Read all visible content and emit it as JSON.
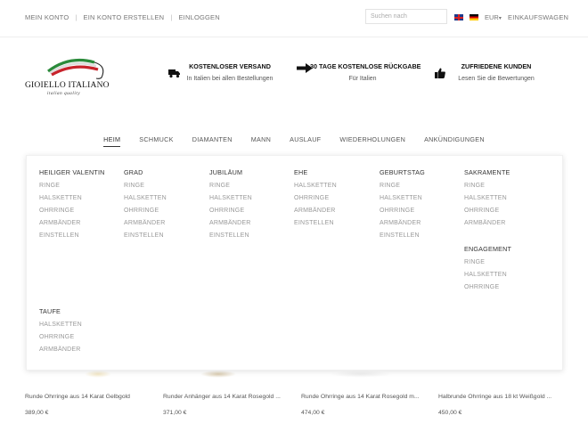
{
  "topbar": {
    "links": [
      "MEIN KONTO",
      "EIN KONTO ERSTELLEN",
      "EINLOGGEN"
    ],
    "search_placeholder": "Suchen nach",
    "currency": "EUR",
    "cart": "EINKAUFSWAGEN"
  },
  "logo": {
    "name": "GIOIELLO ITALIANO",
    "tagline": "italian quality"
  },
  "features": [
    {
      "icon": "truck-icon",
      "title": "KOSTENLOSER VERSAND",
      "subtitle": "In Italien bei allen Bestellungen"
    },
    {
      "icon": "arrow-right-icon",
      "title": "30 TAGE KOSTENLOSE RÜCKGABE",
      "subtitle": "Für Italien"
    },
    {
      "icon": "thumbs-up-icon",
      "title": "ZUFRIEDENE KUNDEN",
      "subtitle": "Lesen Sie die Bewertungen"
    }
  ],
  "nav": [
    "HEIM",
    "SCHMUCK",
    "DIAMANTEN",
    "MANN",
    "AUSLAUF",
    "WIEDERHOLUNGEN",
    "ANKÜNDIGUNGEN"
  ],
  "menu": {
    "valentin": {
      "title": "HEILIGER VALENTIN",
      "items": [
        "RINGE",
        "HALSKETTEN",
        "OHRRINGE",
        "ARMBÄNDER",
        "EINSTELLEN"
      ]
    },
    "grad": {
      "title": "GRAD",
      "items": [
        "RINGE",
        "HALSKETTEN",
        "OHRRINGE",
        "ARMBÄNDER",
        "EINSTELLEN"
      ]
    },
    "jubilaeum": {
      "title": "JUBILÄUM",
      "items": [
        "RINGE",
        "HALSKETTEN",
        "OHRRINGE",
        "ARMBÄNDER",
        "EINSTELLEN"
      ]
    },
    "ehe": {
      "title": "EHE",
      "items": [
        "HALSKETTEN",
        "OHRRINGE",
        "ARMBÄNDER",
        "EINSTELLEN"
      ]
    },
    "geburtstag": {
      "title": "GEBURTSTAG",
      "items": [
        "RINGE",
        "HALSKETTEN",
        "OHRRINGE",
        "ARMBÄNDER",
        "EINSTELLEN"
      ]
    },
    "sakramente": {
      "title": "SAKRAMENTE",
      "items": [
        "RINGE",
        "HALSKETTEN",
        "OHRRINGE",
        "ARMBÄNDER"
      ]
    },
    "engagement": {
      "title": "ENGAGEMENT",
      "items": [
        "RINGE",
        "HALSKETTEN",
        "OHRRINGE"
      ]
    },
    "taufe": {
      "title": "TAUFE",
      "items": [
        "HALSKETTEN",
        "OHRRINGE",
        "ARMBÄNDER"
      ]
    }
  },
  "products": [
    {
      "name": "Runde Ohrringe aus 14 Karat Gelbgold",
      "price": "389,00 €"
    },
    {
      "name": "Runder Anhänger aus 14 Karat Rosegold ...",
      "price": "371,00 €"
    },
    {
      "name": "Runde Ohrringe aus 14 Karat Rosegold m...",
      "price": "474,00 €"
    },
    {
      "name": "Halbrunde Ohrringe aus 18 kt Weißgold ...",
      "price": "450,00 €"
    }
  ]
}
